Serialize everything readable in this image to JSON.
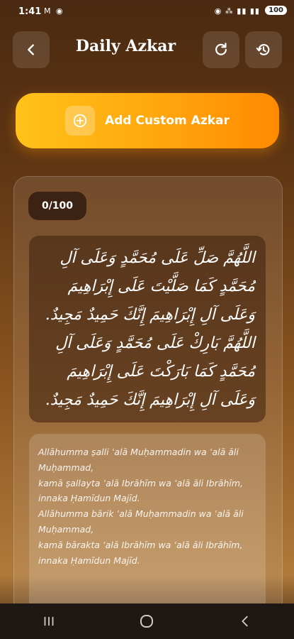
{
  "status_bar": {
    "time": "1:41",
    "left_icons": "M ◉",
    "right_icons": "◉ ⁂ ▮▮ ▮▮",
    "battery": "100"
  },
  "header": {
    "title": "Daily Azkar",
    "back_icon": "chevron-left-icon",
    "refresh_icon": "refresh-icon",
    "history_icon": "history-icon"
  },
  "add_button": {
    "label": "Add Custom Azkar",
    "icon": "plus-circle-icon"
  },
  "counter": "0/100",
  "arabic_text": "اللَّهُمَّ صَلِّ عَلَى مُحَمَّدٍ وَعَلَى آلِ مُحَمَّدٍ كَمَا صَلَّيْتَ عَلَى إِبْرَاهِيمَ وَعَلَى آلِ إِبْرَاهِيمَ إِنَّكَ حَمِيدٌ مَجِيدٌ. اللَّهُمَّ بَارِكْ عَلَى مُحَمَّدٍ وَعَلَى آلِ مُحَمَّدٍ كَمَا بَارَكْتَ عَلَى إِبْرَاهِيمَ وَعَلَى آلِ إِبْرَاهِيمَ إِنَّكَ حَمِيدٌ مَجِيدٌ.",
  "transliteration": [
    "Allāhumma ṣalli ʿalā Muḥammadin wa ʿalā āli Muḥammad,",
    "kamā ṣallayta ʿalā Ibrāhīm wa ʿalā āli Ibrāhīm,",
    "innaka Ḥamīdun Majīd.",
    "Allāhumma bārik ʿalā Muḥammadin wa ʿalā āli Muḥammad,",
    "kamā bārakta ʿalā Ibrāhīm wa ʿalā āli Ibrāhīm,",
    "innaka Ḥamīdun Majīd."
  ],
  "nav": {
    "recents_icon": "recents-icon",
    "home_icon": "home-icon",
    "back_icon": "back-nav-icon"
  },
  "colors": {
    "accent_start": "#ffc21a",
    "accent_end": "#ff8a00",
    "background": "#5e3513"
  }
}
